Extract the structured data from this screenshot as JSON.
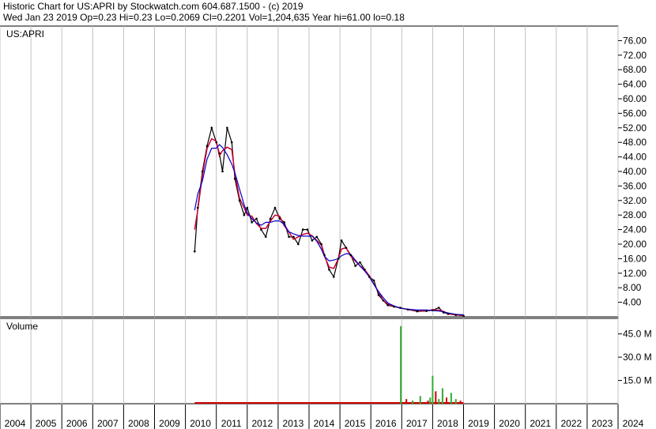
{
  "header": {
    "title_line": "Historic Chart for US:APRI by Stockwatch.com 604.687.1500 - (c) 2019",
    "stats_line": "Wed Jan 23 2019   Op=0.23  Hi=0.23  Lo=0.2069  Cl=0.2201  Vol=1,204,635  Year hi=61.00  lo=0.18"
  },
  "colors": {
    "price_line": "#000000",
    "ma_short": "#cc0033",
    "ma_long": "#0000cc",
    "volume_up": "#33aa33",
    "volume_down": "#cc0000",
    "grid": "#c0c0c0"
  },
  "chart_data": [
    {
      "type": "line",
      "title": "US:APRI",
      "ylim": [
        0,
        80
      ],
      "y_ticks": [
        "76.00",
        "72.00",
        "68.00",
        "64.00",
        "60.00",
        "56.00",
        "52.00",
        "48.00",
        "44.00",
        "40.00",
        "36.00",
        "32.00",
        "28.00",
        "24.00",
        "20.00",
        "16.00",
        "12.00",
        "8.00",
        "4.00"
      ],
      "x_ticks": [
        "2004",
        "2005",
        "2006",
        "2007",
        "2008",
        "2009",
        "2010",
        "2011",
        "2012",
        "2013",
        "2014",
        "2015",
        "2016",
        "2017",
        "2018",
        "2019",
        "2020",
        "2021",
        "2022",
        "2023",
        "2024"
      ],
      "series": [
        {
          "x": [
            2010.3,
            2010.4,
            2010.55,
            2010.7,
            2010.85,
            2011.0,
            2011.1,
            2011.2,
            2011.35,
            2011.5,
            2011.6,
            2011.75,
            2011.9,
            2012.0,
            2012.15,
            2012.3,
            2012.45,
            2012.6,
            2012.75,
            2012.9,
            2013.05,
            2013.2,
            2013.35,
            2013.5,
            2013.65,
            2013.8,
            2013.95,
            2014.1,
            2014.25,
            2014.4,
            2014.5,
            2014.65,
            2014.8,
            2014.95,
            2015.05,
            2015.2,
            2015.35,
            2015.5,
            2015.65,
            2015.8,
            2015.95,
            2016.1,
            2016.25,
            2016.4,
            2016.55,
            2016.75,
            2016.95,
            2017.2,
            2017.5,
            2017.8,
            2018.0,
            2018.2,
            2018.35,
            2018.5,
            2018.75,
            2019.0
          ],
          "values": [
            18,
            30,
            40,
            47,
            52,
            48,
            45,
            40,
            52,
            48,
            38,
            32,
            28,
            30,
            26,
            27,
            24,
            22,
            27,
            30,
            27,
            26,
            22,
            22,
            20,
            24,
            24,
            21,
            22,
            20,
            17,
            13,
            11,
            16,
            21,
            19,
            17,
            14,
            15,
            13,
            11,
            10,
            6,
            4.5,
            3.2,
            2.8,
            2.5,
            2.0,
            1.5,
            1.6,
            1.8,
            2.5,
            1.2,
            0.8,
            0.5,
            0.3
          ]
        }
      ]
    },
    {
      "type": "bar",
      "title": "Volume",
      "ylim": [
        0,
        55
      ],
      "y_ticks": [
        "45.0 M",
        "30.0 M",
        "15.0 M"
      ],
      "x": [
        2016.97,
        2017.15,
        2017.35,
        2017.6,
        2017.85,
        2017.92,
        2018.0,
        2018.1,
        2018.2,
        2018.32,
        2018.45,
        2018.6,
        2018.75,
        2018.9
      ],
      "values": [
        50,
        3,
        2,
        5,
        2,
        4,
        18,
        8,
        3,
        10,
        4,
        7,
        3,
        2
      ]
    }
  ]
}
